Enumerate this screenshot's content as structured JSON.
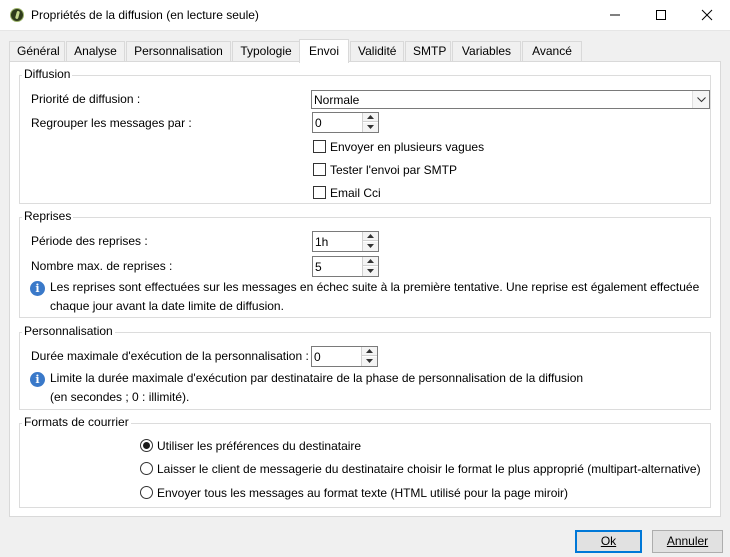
{
  "window": {
    "title": "Propriétés de la diffusion (en lecture seule)",
    "icon": "adobe-campaign-icon"
  },
  "tabs": [
    {
      "label": "Général",
      "active": false
    },
    {
      "label": "Analyse",
      "active": false
    },
    {
      "label": "Personnalisation",
      "active": false
    },
    {
      "label": "Typologie",
      "active": false
    },
    {
      "label": "Envoi",
      "active": true
    },
    {
      "label": "Validité",
      "active": false
    },
    {
      "label": "SMTP",
      "active": false
    },
    {
      "label": "Variables",
      "active": false
    },
    {
      "label": "Avancé",
      "active": false
    }
  ],
  "diffusion": {
    "title": "Diffusion",
    "priority_label": "Priorité de diffusion :",
    "priority_value": "Normale",
    "group_label": "Regrouper les messages par :",
    "group_value": "0",
    "checkboxes": [
      {
        "label": "Envoyer en plusieurs vagues",
        "checked": false
      },
      {
        "label": "Tester l'envoi par SMTP",
        "checked": false
      },
      {
        "label": "Email Cci",
        "checked": false
      }
    ]
  },
  "reprises": {
    "title": "Reprises",
    "period_label": "Période des reprises :",
    "period_value": "1h",
    "max_label": "Nombre max. de reprises :",
    "max_value": "5",
    "note_line1": "Les reprises sont effectuées sur les messages en échec suite à la première tentative. Une reprise est également effectuée",
    "note_line2": "chaque jour avant la date limite de diffusion."
  },
  "personnalisation": {
    "title": "Personnalisation",
    "duration_label": "Durée maximale d'exécution de la personnalisation :",
    "duration_value": "0",
    "note_line1": "Limite la durée maximale d'exécution par destinataire de la phase de personnalisation de la diffusion",
    "note_line2": "(en secondes ; 0 : illimité)."
  },
  "formats": {
    "title": "Formats de courrier",
    "options": [
      {
        "label": "Utiliser les préférences du destinataire",
        "selected": true
      },
      {
        "label": "Laisser le client de messagerie du destinataire choisir le format le plus approprié (multipart-alternative)",
        "selected": false
      },
      {
        "label": "Envoyer tous les messages au format texte (HTML utilisé pour la page miroir)",
        "selected": false
      }
    ]
  },
  "buttons": {
    "ok": "Ok",
    "cancel": "Annuler"
  },
  "colors": {
    "accent": "#0078d7",
    "info": "#3a79c9"
  }
}
